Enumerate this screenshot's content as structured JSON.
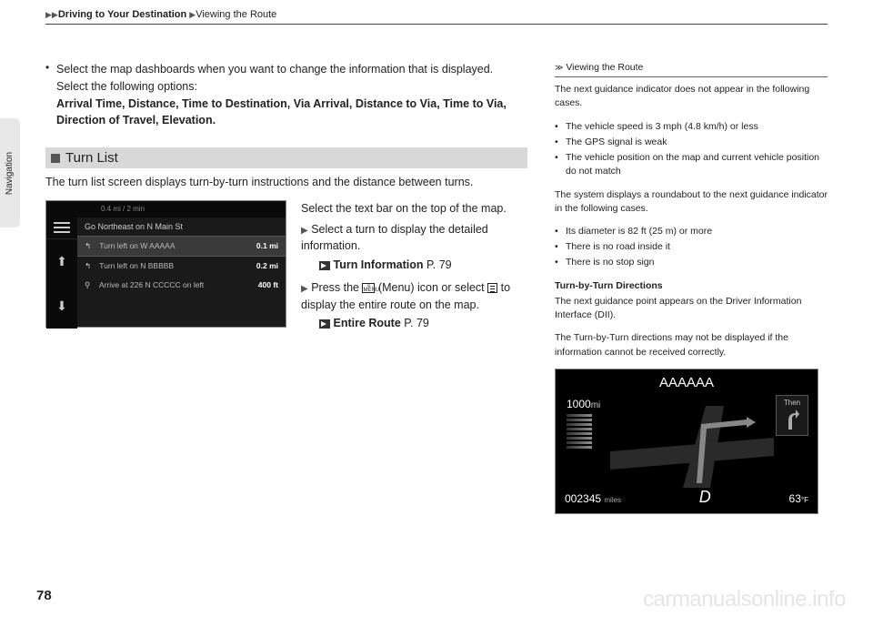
{
  "header": {
    "level1": "Driving to Your Destination",
    "level2": "Viewing the Route"
  },
  "side_tab": "Navigation",
  "main_bullet": {
    "text": "Select the map dashboards when you want to change the information that is displayed. Select the following options:",
    "options": "Arrival Time, Distance, Time to Destination, Via Arrival, Distance to Via, Time to Via, Direction of Travel, Elevation."
  },
  "section_title": "Turn List",
  "intro": "The turn list screen displays turn-by-turn instructions and the distance between turns.",
  "screenshot1": {
    "top_status": "0.4 mi / 2 min",
    "heading": "Go Northeast on N Main St",
    "rows": [
      {
        "icon": "↰",
        "text": "Turn left on W AAAAA",
        "dist": "0.1 mi"
      },
      {
        "icon": "↰",
        "text": "Turn left on N BBBBB",
        "dist": "0.2 mi"
      },
      {
        "icon": "⚲",
        "text": "Arrive at 226 N CCCCC   on left",
        "dist": "400 ft"
      }
    ]
  },
  "instructions": {
    "line1": "Select the text bar on the top of the map.",
    "step1": "Select a turn to display the detailed information.",
    "ref1": "Turn Information",
    "ref1_page": "P. 79",
    "step2a": "Press the ",
    "step2b": " (Menu) icon or select ",
    "step2c": " to display the entire route on the map.",
    "ref2": "Entire Route",
    "ref2_page": "P. 79"
  },
  "right": {
    "head": "Viewing the Route",
    "para1": "The next guidance indicator does not appear in the following cases.",
    "list1": [
      "The vehicle speed is 3 mph (4.8 km/h) or less",
      "The GPS signal is weak",
      "The vehicle position on the map and current vehicle position do not match"
    ],
    "para2": "The system displays a roundabout to the next guidance indicator in the following cases.",
    "list2": [
      "Its diameter is 82 ft (25 m) or more",
      "There is no road inside it",
      "There is no stop sign"
    ],
    "subhead": "Turn-by-Turn Directions",
    "para3": "The next guidance point appears on the Driver Information Interface (DII).",
    "para4": "The Turn-by-Turn directions may not be displayed if the information cannot be received correctly."
  },
  "screenshot2": {
    "title": "AAAAAA",
    "gauge_value": "1000",
    "gauge_unit": "mi",
    "then_label": "Then",
    "odometer": "002345",
    "odo_unit": "miles",
    "gear": "D",
    "temp": "63",
    "temp_unit": "°F"
  },
  "page_number": "78",
  "watermark": "carmanualsonline.info"
}
